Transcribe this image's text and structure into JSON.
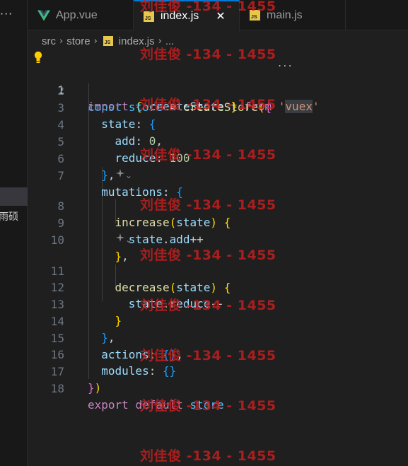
{
  "sidebar": {
    "more_icon": "ellipsis-icon",
    "partial_label": "雨硕"
  },
  "tabs": [
    {
      "label": "App.vue",
      "icon": "vue-icon",
      "active": false
    },
    {
      "label": "index.js",
      "icon": "js-icon",
      "active": true
    },
    {
      "label": "main.js",
      "icon": "js-icon",
      "active": false
    }
  ],
  "js_icon_text": "JS",
  "close_icon": "✕",
  "breadcrumb": {
    "items": [
      "src",
      "store",
      "index.js"
    ],
    "ellipsis": "..."
  },
  "editor": {
    "line_numbers": [
      "1",
      "2",
      "3",
      "4",
      "5",
      "6",
      "7",
      "8",
      "9",
      "10",
      "11",
      "12",
      "13",
      "14",
      "15",
      "16",
      "17",
      "18"
    ],
    "codelens_icon": "copilot-sparkle-icon",
    "lightbulb_icon": "lightbulb-icon",
    "hover_dots": "..."
  },
  "watermark": "刘佳俊 -134 - 1455",
  "colors": {
    "background": "#1f1f1f",
    "accent": "#0078d4",
    "keyword": "#c586c0",
    "string": "#ce9178",
    "function": "#dcdcaa",
    "variable": "#9cdcfe",
    "number": "#b5cea8"
  }
}
